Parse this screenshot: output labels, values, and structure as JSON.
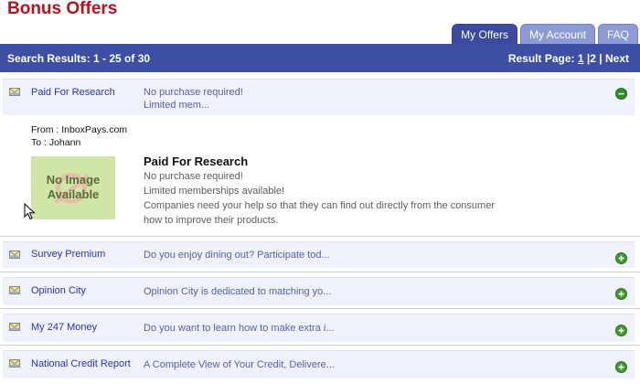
{
  "page": {
    "title": "Bonus Offers"
  },
  "tabs": [
    {
      "label": "My Offers",
      "active": true
    },
    {
      "label": "My Account",
      "active": false
    },
    {
      "label": "FAQ",
      "active": false
    }
  ],
  "results": {
    "summary": "Search Results: 1 - 25 of 30",
    "page_label": "Result Page:",
    "pages": [
      "1",
      "2"
    ],
    "separator": "|",
    "next_label": "Next"
  },
  "offers": [
    {
      "title": "Paid For Research",
      "desc_line1": "No purchase required!",
      "desc_line2": "Limited mem...",
      "toggle": "minus"
    },
    {
      "title": "Survey Premium",
      "desc_line1": "Do you enjoy dining out? Participate tod...",
      "toggle": "plus"
    },
    {
      "title": "Opinion City",
      "desc_line1": "Opinion City is dedicated to matching yo...",
      "toggle": "plus"
    },
    {
      "title": "My 247 Money",
      "desc_line1": "Do you want to learn how to make extra i...",
      "toggle": "plus"
    },
    {
      "title": "National Credit Report",
      "desc_line1": "A Complete View of Your Credit, Delivere...",
      "toggle": "plus"
    }
  ],
  "details": {
    "from": "From : InboxPays.com",
    "to": "To : Johann",
    "image_text_line1": "No Image",
    "image_text_line2": "Available",
    "title": "Paid For Research",
    "lines": [
      "No purchase required!",
      "Limited memberships available!",
      "Companies need your help so that they can find out directly from the consumer",
      "how to improve their products."
    ]
  },
  "colors": {
    "accent": "#3d4fa3",
    "title_red": "#b8121c",
    "row_bg": "#eff2fa",
    "link": "#2636b0"
  },
  "icons": {
    "offer": "envelope-icon",
    "expand": "plus-icon",
    "collapse": "minus-icon",
    "cursor": "mouse-pointer-icon"
  }
}
